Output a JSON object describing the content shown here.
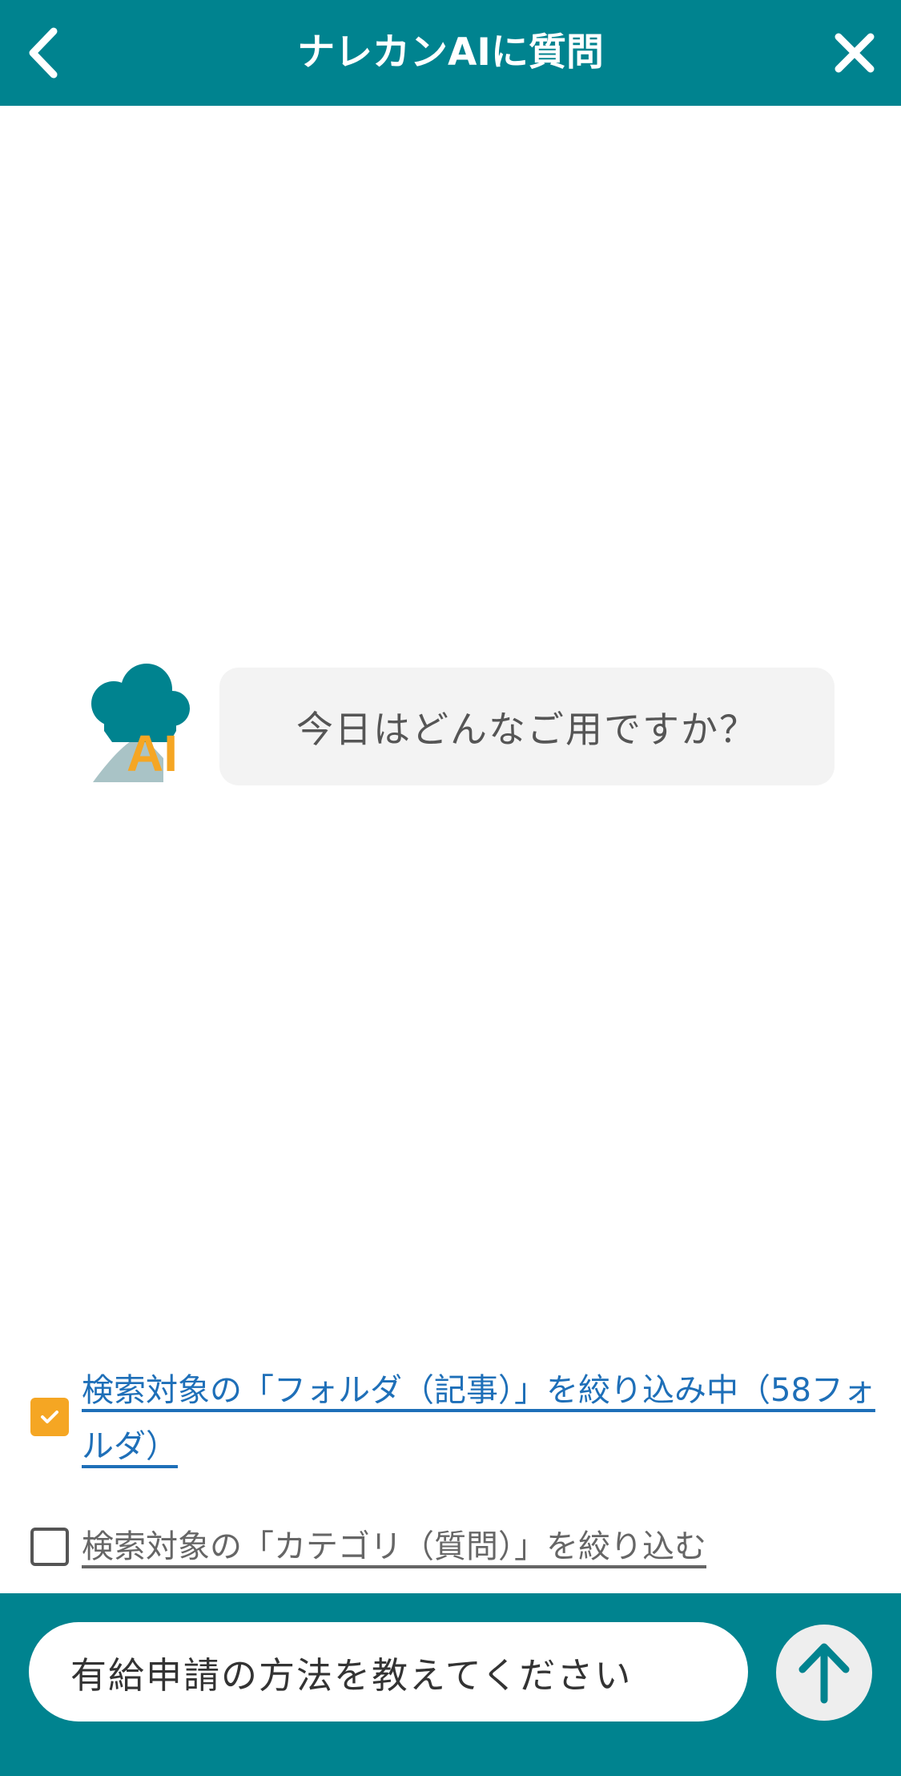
{
  "header": {
    "title": "ナレカンAIに質問",
    "back_icon": "chevron-left-icon",
    "close_icon": "close-icon"
  },
  "chat": {
    "avatar_label": "AI",
    "greeting": "今日はどんなご用ですか？"
  },
  "filters": [
    {
      "label": "検索対象の「フォルダ（記事）」を絞り込み中（58フォルダ）",
      "checked": true
    },
    {
      "label": "検索対象の「カテゴリ（質問）」を絞り込む",
      "checked": false
    }
  ],
  "composer": {
    "value": "有給申請の方法を教えてください",
    "send_icon": "arrow-up-icon"
  },
  "colors": {
    "primary": "#00838f",
    "accent": "#f5a623",
    "link": "#1e6fb8",
    "bubble": "#f3f3f3"
  }
}
